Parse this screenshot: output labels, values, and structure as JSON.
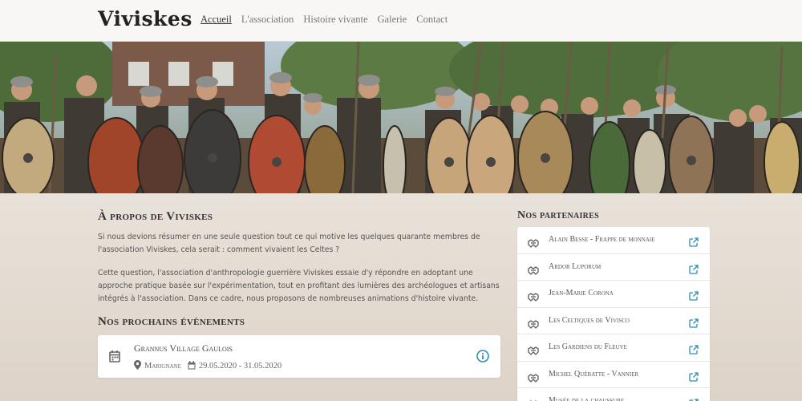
{
  "brand": {
    "logo": "Viviskes"
  },
  "nav": {
    "items": [
      {
        "label": "Accueil",
        "active": true
      },
      {
        "label": "L'association",
        "active": false
      },
      {
        "label": "Histoire vivante",
        "active": false
      },
      {
        "label": "Galerie",
        "active": false
      },
      {
        "label": "Contact",
        "active": false
      }
    ]
  },
  "about": {
    "title": "À propos de Viviskes",
    "paragraph1": "Si nous devions résumer en une seule question tout ce qui motive les quelques quarante membres de l'association Viviskes, cela serait : comment vivaient les Celtes ?",
    "paragraph2": "Cette question, l'association d'anthropologie guerrière Viviskes essaie d'y répondre en adoptant une approche pratique basée sur l'expérimentation, tout en profitant des lumières des archéologues et artisans intégrés à l'association. Dans ce cadre, nous proposons de nombreuses animations d'histoire vivante."
  },
  "events": {
    "title": "Nos prochains évènements",
    "items": [
      {
        "name": "Grannus Village Gaulois",
        "location": "Marignane",
        "dates": "29.05.2020 - 31.05.2020"
      }
    ]
  },
  "partners": {
    "title": "Nos partenaires",
    "items": [
      "Alain Besse - Frappe de monnaie",
      "Ardor Luporum",
      "Jean-Marie Corona",
      "Les Celtiques de Vivisco",
      "Les Gardiens du Fleuve",
      "Michel Québatte - Vannier",
      "Musée de la chaussure"
    ]
  },
  "colors": {
    "accent": "#2a8fb8",
    "icon_gray": "#666666"
  }
}
